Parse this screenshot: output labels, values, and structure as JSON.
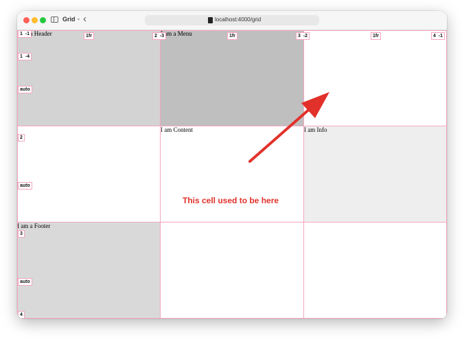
{
  "browser": {
    "tab_group_label": "Grid",
    "tab_chevron": "⌄",
    "back_glyph": "‹",
    "url": "localhost:4000/grid"
  },
  "grid": {
    "areas": {
      "header": {
        "text": "I am a Header",
        "color": "#d3d3d3"
      },
      "menu": {
        "text": "I am a Menu",
        "color": "#c0bfc0"
      },
      "content": {
        "text": "I am Content",
        "color": "#ffffff"
      },
      "info": {
        "text": "I am Info",
        "color": "#eeeeee"
      },
      "footer": {
        "text": "I am a Footer",
        "color": "#d9d9d9"
      }
    },
    "badges": {
      "col1_pos": "1",
      "col1_neg": "-1",
      "col2_pos": "2",
      "col2_neg": "-3",
      "col3_pos": "3",
      "col3_neg": "-2",
      "col4_pos": "4",
      "col4_neg": "-1",
      "row1": "1",
      "row1_neg": "-4",
      "row2": "2",
      "row3": "3",
      "row4": "4",
      "col_track1": "1fr",
      "col_track2": "1fr",
      "col_track3": "1fr",
      "row_track1": "auto",
      "row_track2": "auto",
      "row_track3": "auto"
    },
    "line_color": "#f4a6be"
  },
  "annotation": {
    "text": "This cell used to be here",
    "color": "#e1312a"
  }
}
